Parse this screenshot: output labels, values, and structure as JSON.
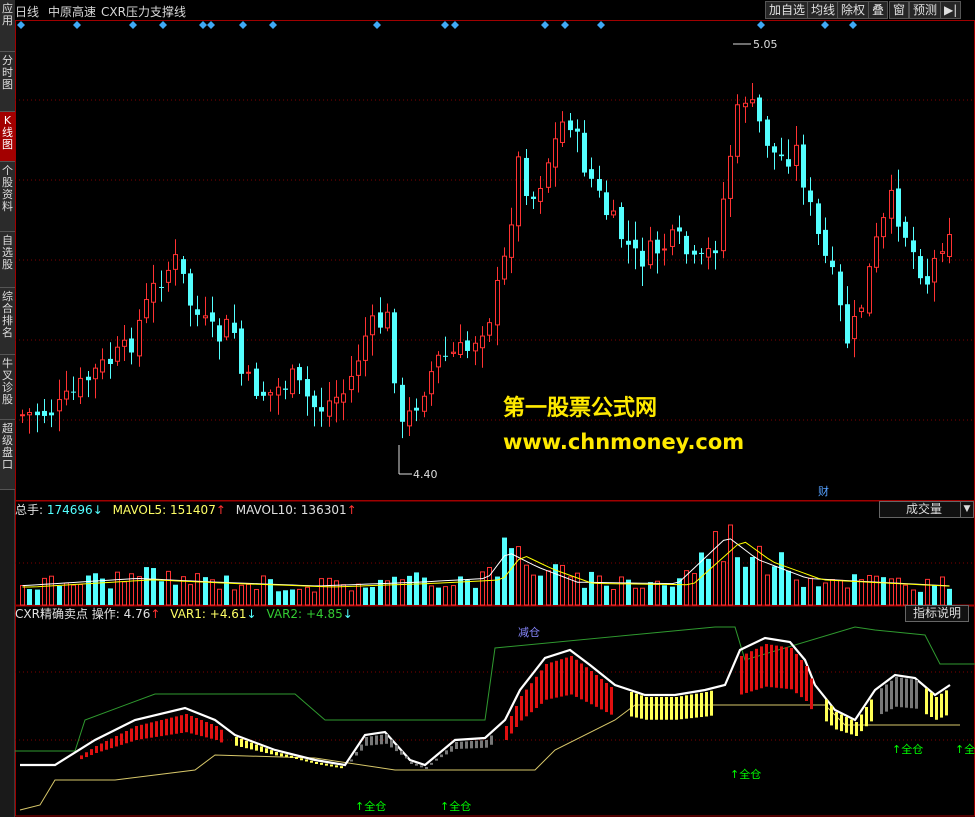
{
  "header": {
    "period": "日线",
    "stock_name": "中原高速",
    "indicator_name": "CXR压力支撑线"
  },
  "toolbar": [
    {
      "id": "add-watchlist",
      "label": "加自选"
    },
    {
      "id": "ma-lines",
      "label": "均线"
    },
    {
      "id": "ex-rights",
      "label": "除权"
    },
    {
      "id": "overlay",
      "label": "叠"
    },
    {
      "id": "window",
      "label": "窗"
    },
    {
      "id": "alert",
      "label": "预测"
    },
    {
      "id": "side-toggle",
      "label": "▶|"
    }
  ],
  "side_tabs": [
    {
      "label": "应用",
      "active": false
    },
    {
      "label": "分时图",
      "active": false
    },
    {
      "label": "K线图",
      "active": true
    },
    {
      "label": "个股资料",
      "active": false
    },
    {
      "label": "自选股",
      "active": false
    },
    {
      "label": "综合排名",
      "active": false
    },
    {
      "label": "牛叉诊股",
      "active": false
    },
    {
      "label": "超级盘口",
      "active": false
    }
  ],
  "price_panel": {
    "high_marker": "5.05",
    "low_marker": "4.40",
    "finance_flag": "财",
    "info_icon_color": "#3fa9f5"
  },
  "watermark": {
    "line1": "第一股票公式网",
    "line2": "www.chnmoney.com"
  },
  "volume_panel": {
    "total_label": "总手:",
    "total_value": "174696",
    "total_arrow": "↓",
    "mavol5_label": "MAVOL5:",
    "mavol5_value": "151407",
    "mavol5_arrow": "↑",
    "mavol10_label": "MAVOL10:",
    "mavol10_value": "136301",
    "mavol10_arrow": "↑",
    "selector_value": "成交量"
  },
  "indicator_panel": {
    "name": "CXR精确卖点",
    "op_label": "操作:",
    "op_value": "4.76",
    "op_arrow": "↑",
    "var1_label": "VAR1:",
    "var1_value": "+4.61",
    "var1_arrow": "↓",
    "var2_label": "VAR2:",
    "var2_value": "+4.85",
    "var2_arrow": "↓",
    "help_button": "指标说明",
    "signal_reduce": "减仓",
    "signal_full": "全仓"
  },
  "colors": {
    "up": "#ff3232",
    "down": "#54ffff",
    "grid": "#800000",
    "border": "#a00000",
    "white": "#ffffff",
    "yellow": "#ffff00",
    "green": "#00ff00",
    "mavol5": "#ffffff",
    "mavol10": "#ffff00"
  }
}
